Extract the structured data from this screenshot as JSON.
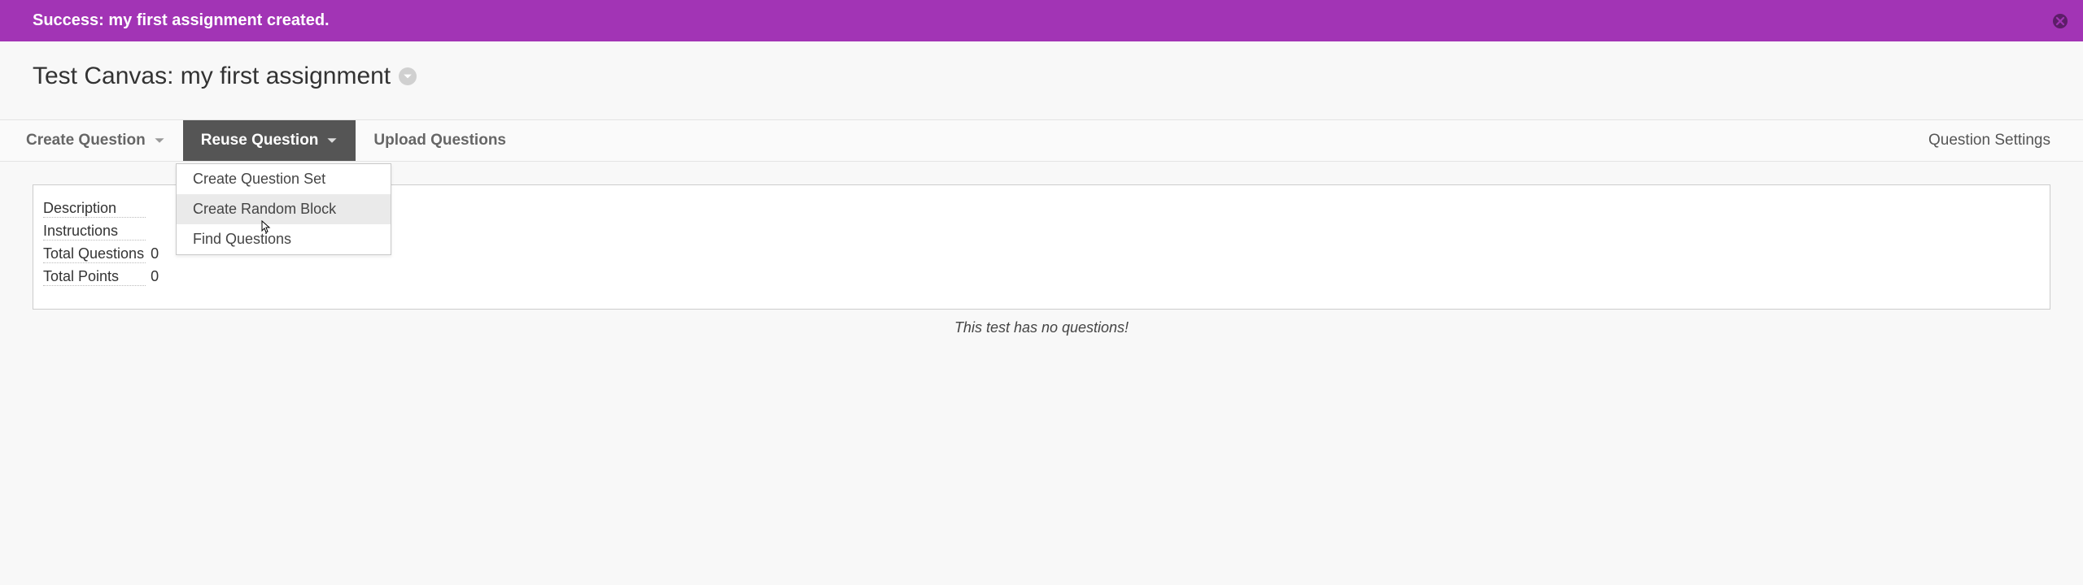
{
  "banner": {
    "text": "Success: my first assignment created."
  },
  "header": {
    "title": "Test Canvas: my first assignment"
  },
  "toolbar": {
    "create_question_label": "Create Question",
    "reuse_question_label": "Reuse Question",
    "upload_questions_label": "Upload Questions",
    "question_settings_label": "Question Settings"
  },
  "reuse_dropdown": {
    "items": [
      {
        "label": "Create Question Set"
      },
      {
        "label": "Create Random Block"
      },
      {
        "label": "Find Questions"
      }
    ],
    "hover_index": 1
  },
  "meta": {
    "description_label": "Description",
    "description_value": "",
    "instructions_label": "Instructions",
    "instructions_value": "",
    "total_questions_label": "Total Questions",
    "total_questions_value": "0",
    "total_points_label": "Total Points",
    "total_points_value": "0"
  },
  "empty_message": "This test has no questions!"
}
